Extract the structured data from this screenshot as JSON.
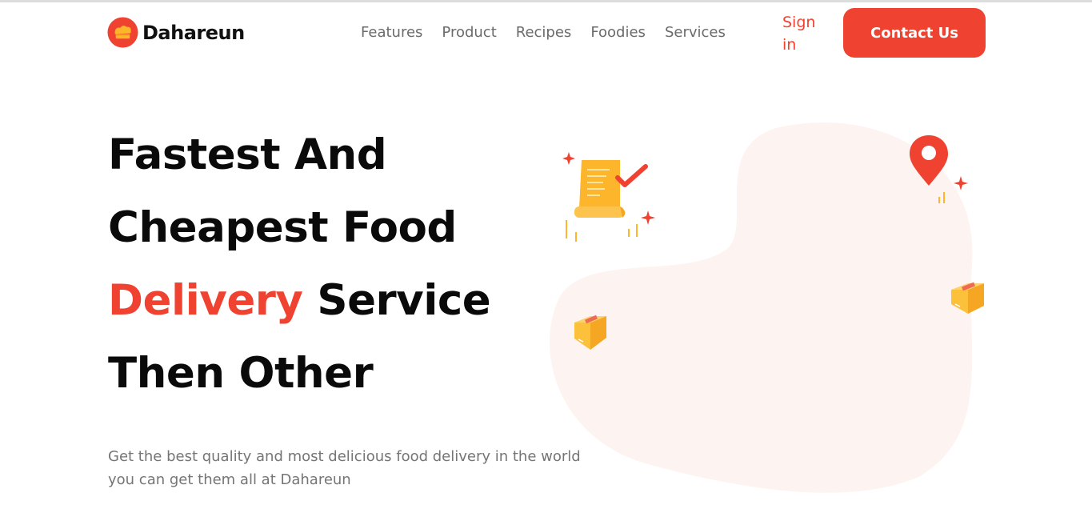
{
  "brand": {
    "name": "Dahareun",
    "logo_icon": "chef-hat-logo-icon",
    "accent_color": "#ef4230"
  },
  "nav": {
    "links": [
      "Features",
      "Product",
      "Recipes",
      "Foodies",
      "Services"
    ],
    "signin_label": "Sign in",
    "contact_label": "Contact Us"
  },
  "hero": {
    "title_lines": [
      {
        "parts": [
          {
            "text": "Fastest And",
            "accent": false
          }
        ]
      },
      {
        "parts": [
          {
            "text": "Cheapest Food",
            "accent": false
          }
        ]
      },
      {
        "parts": [
          {
            "text": "Delivery",
            "accent": true
          },
          {
            "text": " Service",
            "accent": false
          }
        ]
      },
      {
        "parts": [
          {
            "text": "Then Other",
            "accent": false
          }
        ]
      }
    ],
    "description": "Get the best quality and most delicious food delivery in the world you can get them all at Dahareun"
  },
  "illustration": {
    "icons": [
      "order-receipt-icon",
      "location-pin-icon",
      "package-box-icon",
      "sparkle-icon"
    ],
    "colors": {
      "blob": "#fdf3f1",
      "receipt": "#fdb52b",
      "pin": "#ef4230",
      "box": "#fcc13a"
    }
  }
}
